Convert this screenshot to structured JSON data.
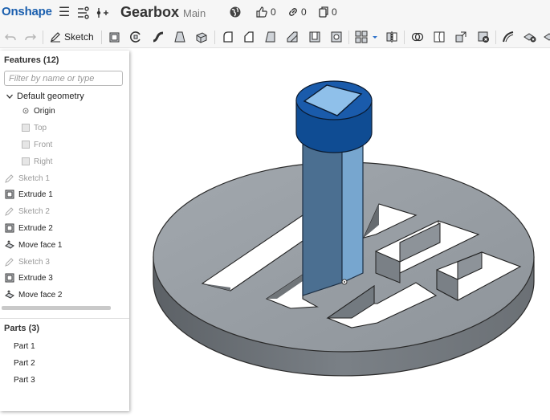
{
  "topbar": {
    "logo": "Onshape",
    "title": "Gearbox",
    "branch": "Main",
    "likes": "0",
    "links": "0",
    "copies": "0"
  },
  "toolbar": {
    "sketch_label": "Sketch"
  },
  "features": {
    "heading": "Features (12)",
    "filter_placeholder": "Filter by name or type",
    "default_geometry": "Default geometry",
    "origin": "Origin",
    "planes": [
      "Top",
      "Front",
      "Right"
    ],
    "items": [
      {
        "label": "Sketch 1",
        "kind": "sketch"
      },
      {
        "label": "Extrude 1",
        "kind": "extrude"
      },
      {
        "label": "Sketch 2",
        "kind": "sketch"
      },
      {
        "label": "Extrude 2",
        "kind": "extrude"
      },
      {
        "label": "Move face 1",
        "kind": "move-face"
      },
      {
        "label": "Sketch 3",
        "kind": "sketch"
      },
      {
        "label": "Extrude 3",
        "kind": "extrude"
      },
      {
        "label": "Move face 2",
        "kind": "move-face"
      }
    ]
  },
  "parts": {
    "heading": "Parts (3)",
    "items": [
      "Part 1",
      "Part 2",
      "Part 3"
    ]
  },
  "colors": {
    "accent": "#1b5fae",
    "selected_face": "#0f4c93",
    "part_gray": "#9aa0a6"
  }
}
